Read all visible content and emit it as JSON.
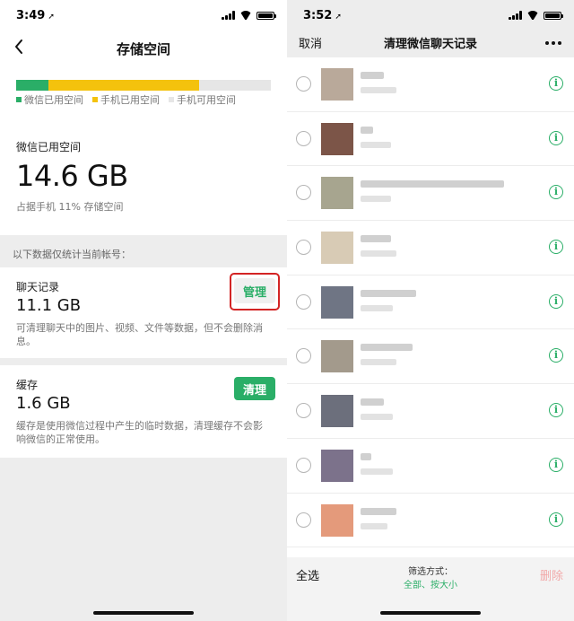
{
  "left": {
    "status": {
      "time": "3:49",
      "location_glyph": "➚"
    },
    "nav": {
      "title": "存储空间"
    },
    "storage": {
      "wechat_used_fraction": 0.125,
      "phone_used_fraction": 0.72,
      "legend": [
        {
          "label": "微信已用空间",
          "color": "#2aae67"
        },
        {
          "label": "手机已用空间",
          "color": "#f4c20d"
        },
        {
          "label": "手机可用空间",
          "color": "#e6e6e6"
        }
      ],
      "used_label": "微信已用空间",
      "used_value": "14.6 GB",
      "used_sub": "占据手机 11% 存储空间"
    },
    "section_note": "以下数据仅统计当前帐号：",
    "chat": {
      "title": "聊天记录",
      "value": "11.1 GB",
      "desc": "可清理聊天中的图片、视频、文件等数据，但不会删除消息。",
      "button": "管理"
    },
    "cache": {
      "title": "缓存",
      "value": "1.6 GB",
      "desc": "缓存是使用微信过程中产生的临时数据，清理缓存不会影响微信的正常使用。",
      "button": "清理"
    }
  },
  "right": {
    "status": {
      "time": "3:52",
      "location_glyph": "➚"
    },
    "nav": {
      "cancel": "取消",
      "title": "清理微信聊天记录"
    },
    "rows": [
      {
        "avatar_color": "#b9a99a"
      },
      {
        "avatar_color": "#7c5548"
      },
      {
        "avatar_color": "#a7a58f"
      },
      {
        "avatar_color": "#d8cbb5"
      },
      {
        "avatar_color": "#6f7584"
      },
      {
        "avatar_color": "#a39a8c"
      },
      {
        "avatar_color": "#6c6f7c"
      },
      {
        "avatar_color": "#7c728b"
      },
      {
        "avatar_color": "#e49a7b"
      }
    ],
    "bottom": {
      "select_all": "全选",
      "filter_label": "筛选方式：",
      "filter_value": "全部、按大小",
      "delete": "删除"
    },
    "accent": "#2aae67"
  }
}
